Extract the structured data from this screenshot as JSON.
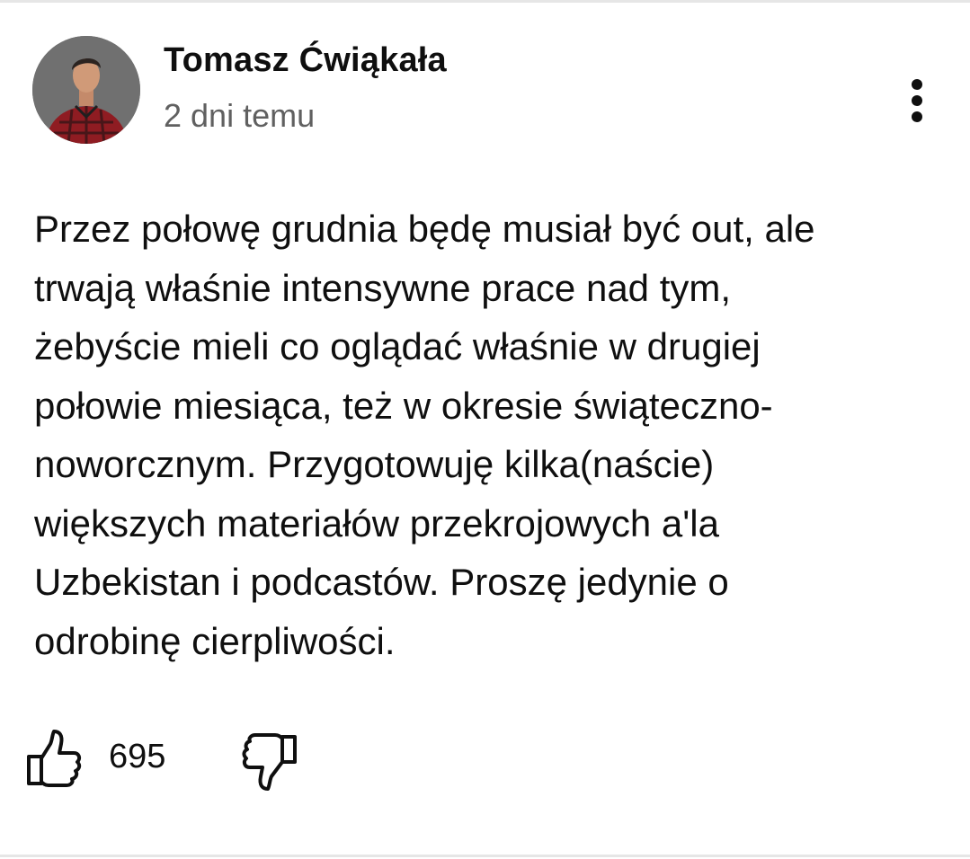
{
  "post": {
    "author": "Tomasz Ćwiąkała",
    "timestamp": "2 dni temu",
    "avatar_icon": "user-avatar-photo",
    "menu_icon": "more-vertical-icon",
    "text_lines": [
      "Przez połowę grudnia będę musiał być out, ale",
      "trwają właśnie intensywne prace nad tym,",
      "żebyście mieli co oglądać właśnie w drugiej",
      "połowie miesiąca, też w okresie świąteczno-",
      "noworcznym. Przygotowuję kilka(naście)",
      "większych materiałów przekrojowych a'la",
      "Uzbekistan i podcastów. Proszę jedynie o",
      "odrobinę cierpliwości."
    ]
  },
  "actions": {
    "like_icon": "thumbs-up-icon",
    "like_count": "695",
    "dislike_icon": "thumbs-down-icon"
  },
  "colors": {
    "text": "#0f0f0f",
    "secondary_text": "#606060",
    "background": "#ffffff",
    "divider": "#e6e6e6"
  }
}
